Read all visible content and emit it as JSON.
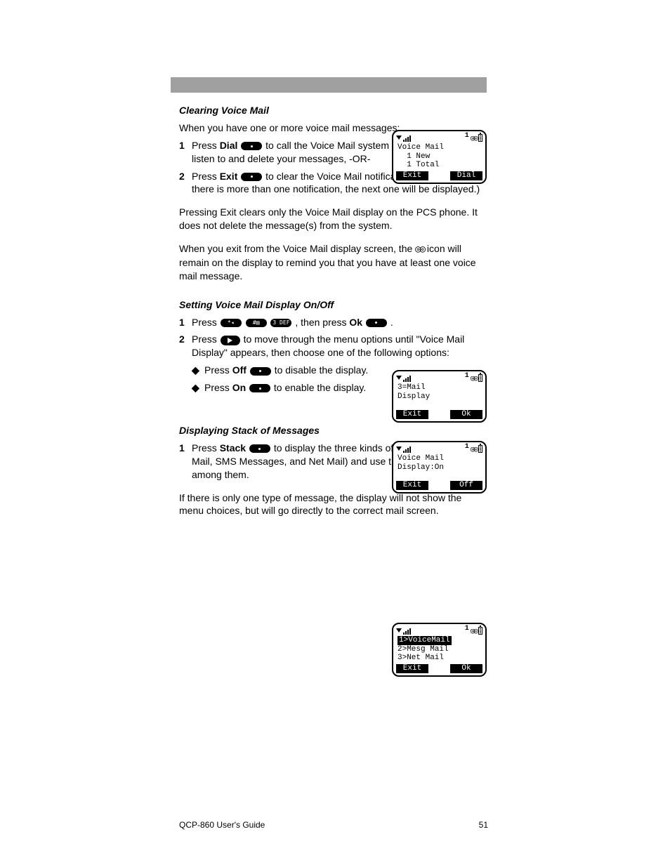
{
  "header_placeholder": "",
  "section1": {
    "title": "Clearing Voice Mail",
    "intro": "When you have one or more voice mail messages:",
    "steps": [
      {
        "n": "1",
        "text_before": "Press ",
        "bold": "Dial",
        "key": "pill-dot",
        "text_after": " to call the Voice Mail system where you can listen to and delete your messages, -OR-"
      },
      {
        "n": "2",
        "text_before": "Press ",
        "bold": "Exit",
        "key": "pill-dot",
        "text_after": " to clear the Voice Mail notification display. (If there is more than one notification, the next one will be displayed.)"
      }
    ],
    "notes": [
      "Pressing Exit clears only the Voice Mail display on the PCS phone. It does not delete the message(s) from the system.",
      "When you exit from the Voice Mail display screen, the         icon will remain on the display to remind you that you have at least one voice mail message."
    ],
    "tape_symbol": "◎◎"
  },
  "section2": {
    "title": "Setting Voice Mail Display On/Off",
    "steps": [
      {
        "n": "1",
        "text": "Press ",
        "keys": [
          "star",
          "hash",
          "3def"
        ],
        "text2": ", then press ",
        "bold": "Ok",
        "key": "pill-dot",
        "text3": "."
      },
      {
        "n": "2",
        "text": "Press ",
        "key": "send",
        "text2": " to move through the menu options until \"Voice Mail Display\" appears, then choose one of the following options:"
      }
    ],
    "bullets": [
      {
        "text_before": "Press ",
        "bold": "Off",
        "key": "pill-dot",
        "text_after": " to disable the display."
      },
      {
        "text_before": "Press ",
        "bold": "On",
        "key": "pill-dot",
        "text_after": " to enable the display."
      }
    ]
  },
  "section3": {
    "title": "Displaying Stack of Messages",
    "steps": [
      {
        "n": "1",
        "text_before": "Press ",
        "bold": "Stack",
        "key": "pill-dot",
        "text_after": " to display the three kinds of mail notice (Voice Mail, SMS Messages, and Net Mail) and use the ",
        "key2": "dir",
        "text_after2": " to scroll among them."
      }
    ],
    "note": "If there is only one type of message, the display will not show the menu choices, but will go directly to the correct mail screen."
  },
  "lcd1": {
    "count": "1",
    "line1": "Voice Mail",
    "line2": "  1 New",
    "line3": "  1 Total",
    "left": "Exit",
    "right": "Dial"
  },
  "lcd2": {
    "count": "1",
    "line1": "3=Mail",
    "line2": "Display",
    "line3": "",
    "left": "Exit",
    "right": "Ok"
  },
  "lcd3": {
    "count": "1",
    "line1": "Voice Mail",
    "line2": "Display:On",
    "line3": "",
    "left": "Exit",
    "right": "Off"
  },
  "lcd4": {
    "count": "1",
    "line1_inv": "1>VoiceMail",
    "line2": "2>Mesg Mail",
    "line3": "3>Net Mail",
    "left": "Exit",
    "right": "Ok"
  },
  "footer": {
    "left": "QCP-860 User's Guide",
    "right": "51"
  }
}
